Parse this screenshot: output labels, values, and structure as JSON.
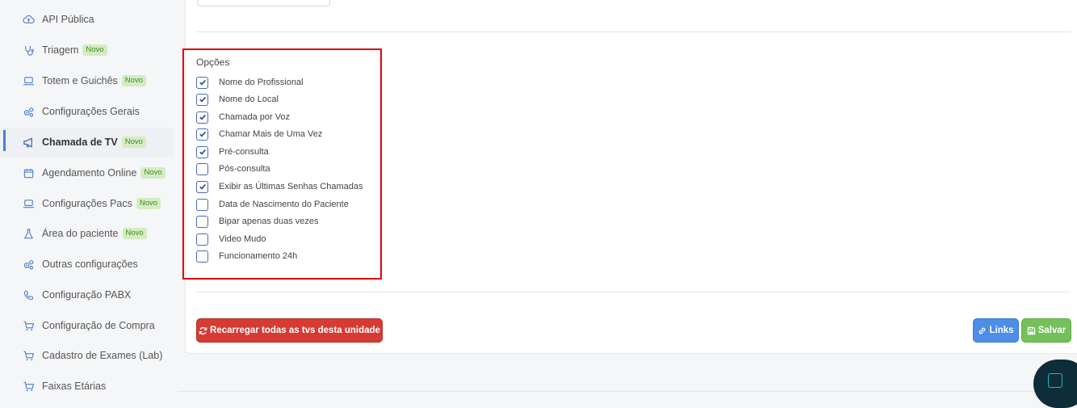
{
  "sidebar": {
    "items": [
      {
        "label": "API Pública",
        "icon": "cloud-upload-icon",
        "badge": ""
      },
      {
        "label": "Triagem",
        "icon": "stethoscope-icon",
        "badge": "Novo"
      },
      {
        "label": "Totem e Guichês",
        "icon": "laptop-icon",
        "badge": "Novo"
      },
      {
        "label": "Configurações Gerais",
        "icon": "gears-icon",
        "badge": ""
      },
      {
        "label": "Chamada de TV",
        "icon": "megaphone-icon",
        "badge": "Novo",
        "active": true
      },
      {
        "label": "Agendamento Online",
        "icon": "calendar-icon",
        "badge": "Novo"
      },
      {
        "label": "Configurações Pacs",
        "icon": "laptop-icon",
        "badge": "Novo"
      },
      {
        "label": "Área do paciente",
        "icon": "flask-icon",
        "badge": "Novo"
      },
      {
        "label": "Outras configurações",
        "icon": "gears-icon",
        "badge": ""
      },
      {
        "label": "Configuração PABX",
        "icon": "phone-icon",
        "badge": ""
      },
      {
        "label": "Configuração de Compra",
        "icon": "cart-icon",
        "badge": ""
      },
      {
        "label": "Cadastro de Exames (Lab)",
        "icon": "cart-icon",
        "badge": ""
      },
      {
        "label": "Faixas Etárias",
        "icon": "cart-icon",
        "badge": ""
      }
    ]
  },
  "options": {
    "title": "Opções",
    "items": [
      {
        "label": "Nome do Profissional",
        "checked": true
      },
      {
        "label": "Nome do Local",
        "checked": true
      },
      {
        "label": "Chamada por Voz",
        "checked": true
      },
      {
        "label": "Chamar Mais de Uma Vez",
        "checked": true
      },
      {
        "label": "Pré-consulta",
        "checked": true
      },
      {
        "label": "Pós-consulta",
        "checked": false
      },
      {
        "label": "Exibir as Últimas Senhas Chamadas",
        "checked": true
      },
      {
        "label": "Data de Nascimento do Paciente",
        "checked": false
      },
      {
        "label": "Bipar apenas duas vezes",
        "checked": false
      },
      {
        "label": "Video Mudo",
        "checked": false
      },
      {
        "label": "Funcionamento 24h",
        "checked": false
      }
    ]
  },
  "actions": {
    "reload_label": "Recarregar todas as tvs desta unidade",
    "links_label": "Links",
    "save_label": "Salvar"
  },
  "colors": {
    "highlight_border": "#e00000",
    "reload": "#d63b33",
    "links": "#4e8ee6",
    "save": "#74c05a",
    "badge_bg": "#d4ecc3",
    "badge_text": "#3e8c21"
  }
}
